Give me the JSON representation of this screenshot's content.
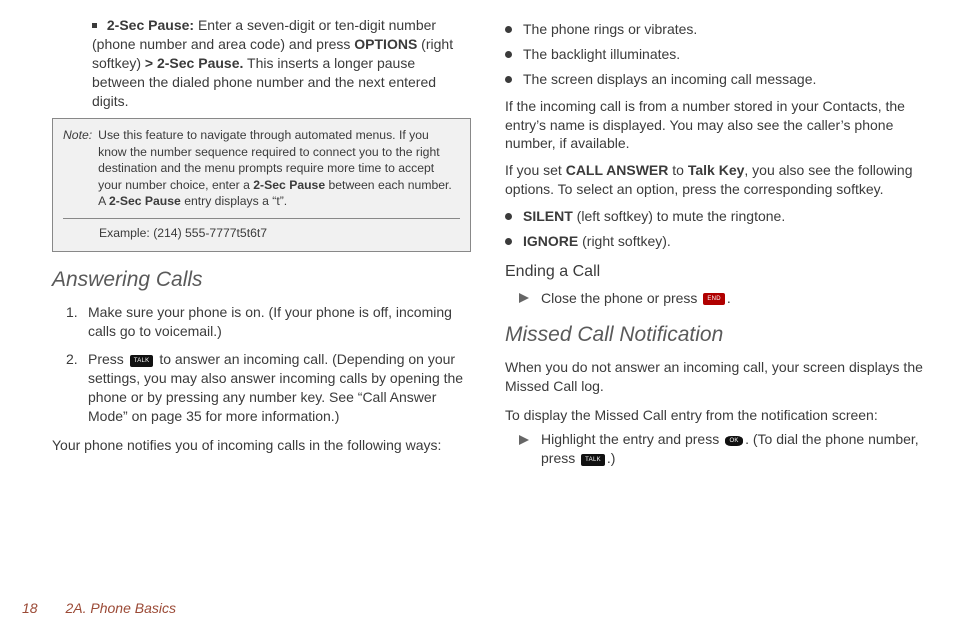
{
  "col1": {
    "nested_bullet": {
      "label": "2-Sec Pause:",
      "text_before_options": " Enter a seven-digit or ten-digit number (phone number and area code) and press ",
      "options": "OPTIONS",
      "after_options": " (right softkey) ",
      "gt": ">",
      "pause": " 2-Sec Pause.",
      "tail": " This inserts a longer pause between the dialed phone number and the next entered digits."
    },
    "note": {
      "label": "Note:",
      "body_a": "Use this feature to navigate through automated menus. If you know the number sequence required to connect you to the right destination and the menu prompts require more time to accept your number choice, enter a ",
      "b1": "2-Sec Pause",
      "body_b": " between each number. A ",
      "b2": "2-Sec Pause",
      "body_c": " entry displays a “t”.",
      "example": "Example: (214) 555-7777t5t6t7"
    },
    "h_answer": "Answering Calls",
    "step1_num": "1.",
    "step1": "Make sure your phone is on. (If your phone is off, incoming calls go to voicemail.)",
    "step2_num": "2.",
    "step2_a": "Press ",
    "step2_key": "TALK",
    "step2_b": " to answer an incoming call. (Depending on your settings, you may also answer incoming calls by opening the phone or by pressing any number key. See “Call Answer Mode” on page 35 for more information.)",
    "notify_para": "Your phone notifies you of incoming calls in the following ways:"
  },
  "col2": {
    "b1": "The phone rings or vibrates.",
    "b2": "The backlight illuminates.",
    "b3": "The screen displays an incoming call message.",
    "para_incoming": "If the incoming call is from a number stored in your Contacts, the entry’s name is displayed. You may also see the caller’s phone number, if available.",
    "para_set_a": "If you set ",
    "para_set_b": "CALL ANSWER",
    "para_set_c": " to ",
    "para_set_d": "Talk Key",
    "para_set_e": ", you also see the following options. To select an option, press the corresponding softkey.",
    "opt1_b": "SILENT",
    "opt1_t": " (left softkey) to mute the ringtone.",
    "opt2_b": "IGNORE",
    "opt2_t": " (right softkey).",
    "h_end": "Ending a Call",
    "end_a": "Close the phone or press ",
    "end_key": "END",
    "end_dot": ".",
    "h_missed": "Missed Call Notification",
    "missed_p": "When you do not answer an incoming call, your screen displays the Missed Call log.",
    "missed_howto": "To display the Missed Call entry from the notification screen:",
    "mc_a": "Highlight the entry and press ",
    "mc_ok": "OK",
    "mc_b": ". (To dial the phone number, press ",
    "mc_talk": "TALK",
    "mc_c": ".)"
  },
  "footer": {
    "page": "18",
    "section": "2A. Phone Basics"
  }
}
